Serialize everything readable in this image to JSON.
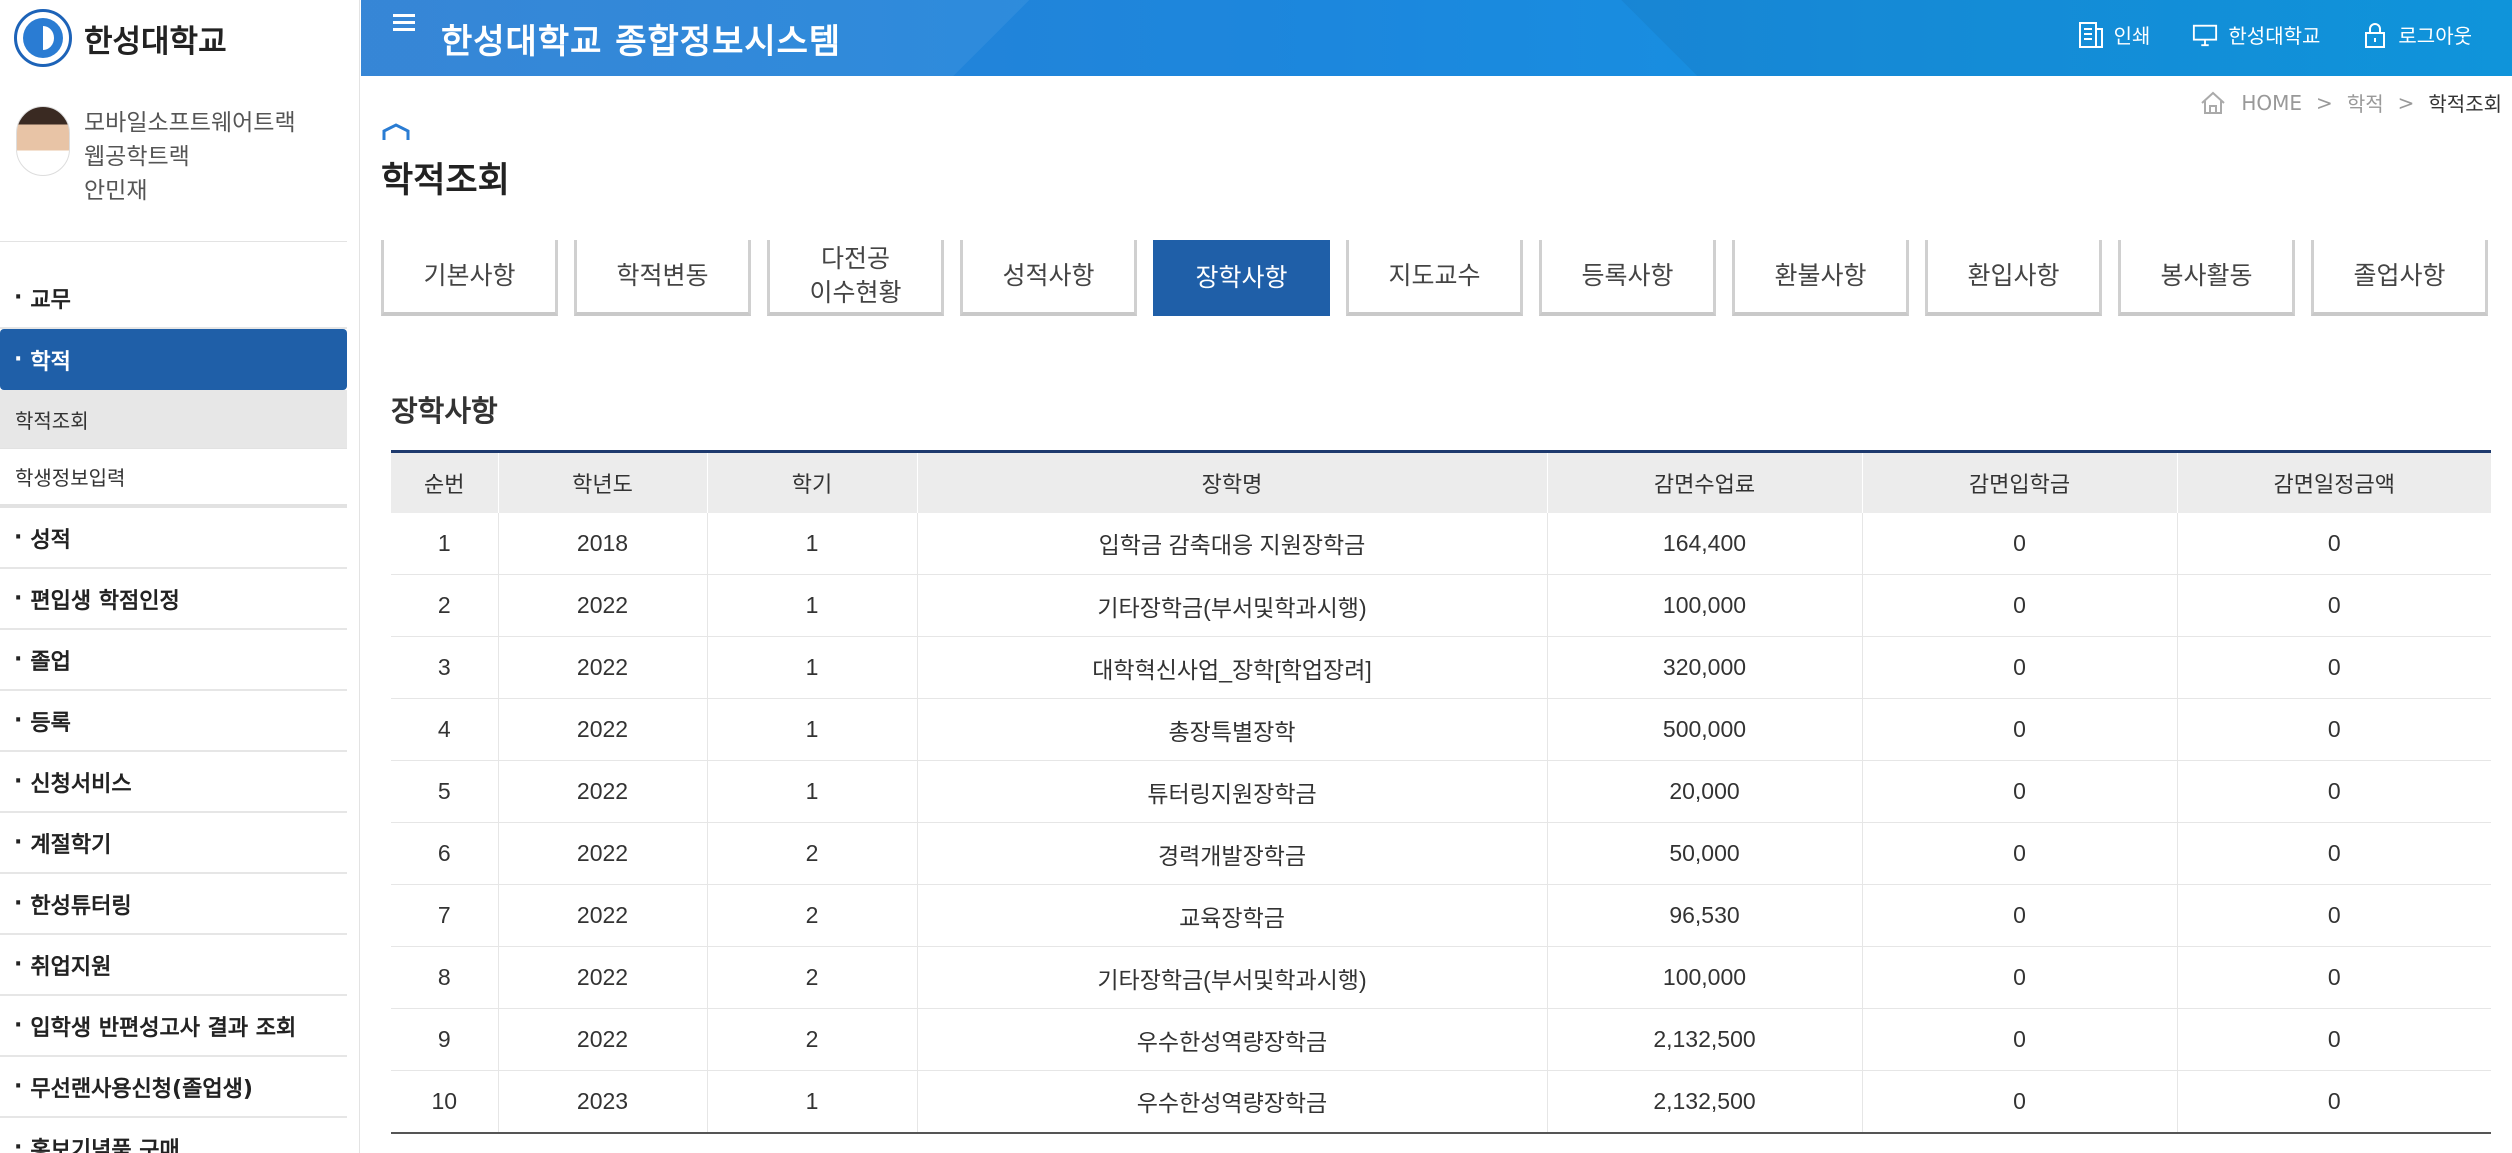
{
  "brand": {
    "name": "한성대학교"
  },
  "profile": {
    "line1": "모바일소프트웨어트랙",
    "line2": "웹공학트랙",
    "name": "안민재"
  },
  "menu": {
    "items": [
      {
        "label": "교무"
      },
      {
        "label": "학적",
        "active": true
      },
      {
        "label": "성적"
      },
      {
        "label": "편입생 학점인정"
      },
      {
        "label": "졸업"
      },
      {
        "label": "등록"
      },
      {
        "label": "신청서비스"
      },
      {
        "label": "계절학기"
      },
      {
        "label": "한성튜터링"
      },
      {
        "label": "취업지원"
      },
      {
        "label": "입학생 반편성고사 결과 조회"
      },
      {
        "label": "무선랜사용신청(졸업생)"
      },
      {
        "label": "홍보기념품 구매"
      }
    ],
    "sub": [
      {
        "label": "학적조회"
      },
      {
        "label": "학생정보입력"
      }
    ]
  },
  "header": {
    "title": "한성대학교 종합정보시스템",
    "print_label": "인쇄",
    "site_label": "한성대학교",
    "logout_label": "로그아웃",
    "accent_color": "#1c87dd"
  },
  "breadcrumb": {
    "home": "HOME",
    "level1": "학적",
    "current": "학적조회"
  },
  "page": {
    "title": "학적조회"
  },
  "tabs": [
    {
      "label": "기본사항"
    },
    {
      "label": "학적변동"
    },
    {
      "label_line1": "다전공",
      "label_line2": "이수현황"
    },
    {
      "label": "성적사항"
    },
    {
      "label": "장학사항",
      "active": true
    },
    {
      "label": "지도교수"
    },
    {
      "label": "등록사항"
    },
    {
      "label": "환불사항"
    },
    {
      "label": "환입사항"
    },
    {
      "label": "봉사활동"
    },
    {
      "label": "졸업사항"
    }
  ],
  "section": {
    "title": "장학사항"
  },
  "table": {
    "headers": [
      "순번",
      "학년도",
      "학기",
      "장학명",
      "감면수업료",
      "감면입학금",
      "감면일정금액"
    ],
    "rows": [
      [
        "1",
        "2018",
        "1",
        "입학금 감축대응 지원장학금",
        "164,400",
        "0",
        "0"
      ],
      [
        "2",
        "2022",
        "1",
        "기타장학금(부서및학과시행)",
        "100,000",
        "0",
        "0"
      ],
      [
        "3",
        "2022",
        "1",
        "대학혁신사업_장학[학업장려]",
        "320,000",
        "0",
        "0"
      ],
      [
        "4",
        "2022",
        "1",
        "총장특별장학",
        "500,000",
        "0",
        "0"
      ],
      [
        "5",
        "2022",
        "1",
        "튜터링지원장학금",
        "20,000",
        "0",
        "0"
      ],
      [
        "6",
        "2022",
        "2",
        "경력개발장학금",
        "50,000",
        "0",
        "0"
      ],
      [
        "7",
        "2022",
        "2",
        "교육장학금",
        "96,530",
        "0",
        "0"
      ],
      [
        "8",
        "2022",
        "2",
        "기타장학금(부서및학과시행)",
        "100,000",
        "0",
        "0"
      ],
      [
        "9",
        "2022",
        "2",
        "우수한성역량장학금",
        "2,132,500",
        "0",
        "0"
      ],
      [
        "10",
        "2023",
        "1",
        "우수한성역량장학금",
        "2,132,500",
        "0",
        "0"
      ]
    ]
  }
}
